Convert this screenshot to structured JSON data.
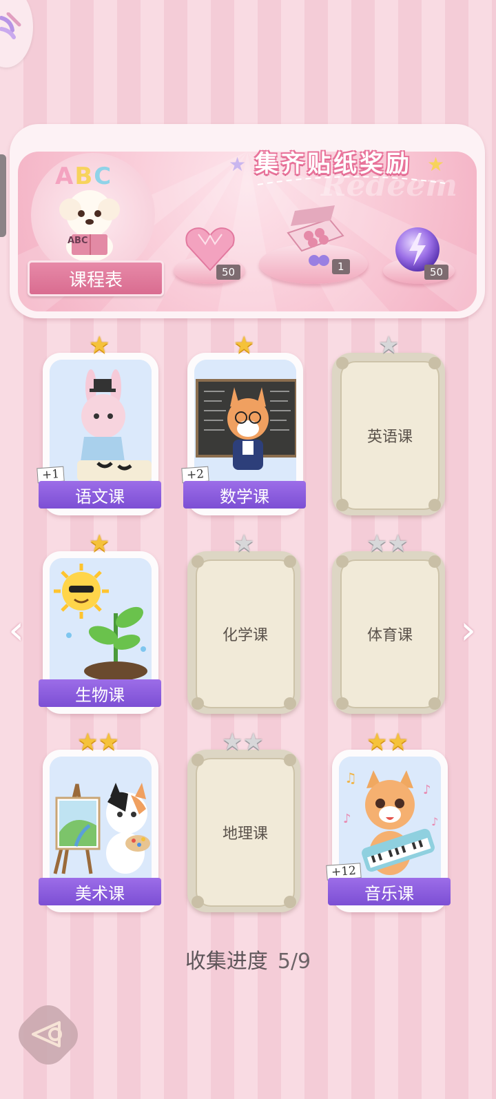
{
  "banner": {
    "title": "集齐贴纸奖励",
    "deco_text": "Redeem",
    "schedule_label": "课程表",
    "abc": "ABC",
    "rewards": [
      {
        "icon": "pink-heart-gem-icon",
        "count": "50"
      },
      {
        "icon": "gift-box-icon",
        "count": "1"
      },
      {
        "icon": "purple-energy-orb-icon",
        "count": "50"
      }
    ]
  },
  "cards": [
    {
      "label": "语文课",
      "unlocked": true,
      "stars": [
        "gold"
      ],
      "plus": "+1"
    },
    {
      "label": "数学课",
      "unlocked": true,
      "stars": [
        "gold"
      ],
      "plus": "+2"
    },
    {
      "label": "英语课",
      "unlocked": false,
      "stars": [
        "silver"
      ]
    },
    {
      "label": "生物课",
      "unlocked": true,
      "stars": [
        "gold"
      ]
    },
    {
      "label": "化学课",
      "unlocked": false,
      "stars": [
        "silver"
      ]
    },
    {
      "label": "体育课",
      "unlocked": false,
      "stars": [
        "silver",
        "silver"
      ]
    },
    {
      "label": "美术课",
      "unlocked": true,
      "stars": [
        "gold",
        "gold"
      ]
    },
    {
      "label": "地理课",
      "unlocked": false,
      "stars": [
        "silver",
        "silver"
      ]
    },
    {
      "label": "音乐课",
      "unlocked": true,
      "stars": [
        "gold",
        "gold"
      ],
      "plus": "+12"
    }
  ],
  "progress": {
    "label": "收集进度",
    "value": "5/9"
  },
  "nav": {
    "prev": "‹",
    "next": "›"
  },
  "colors": {
    "gold_star": "#f5c23a",
    "silver_star": "#d7d7d9",
    "label_purple": "#8a5ddf",
    "pink": "#e8739a"
  }
}
